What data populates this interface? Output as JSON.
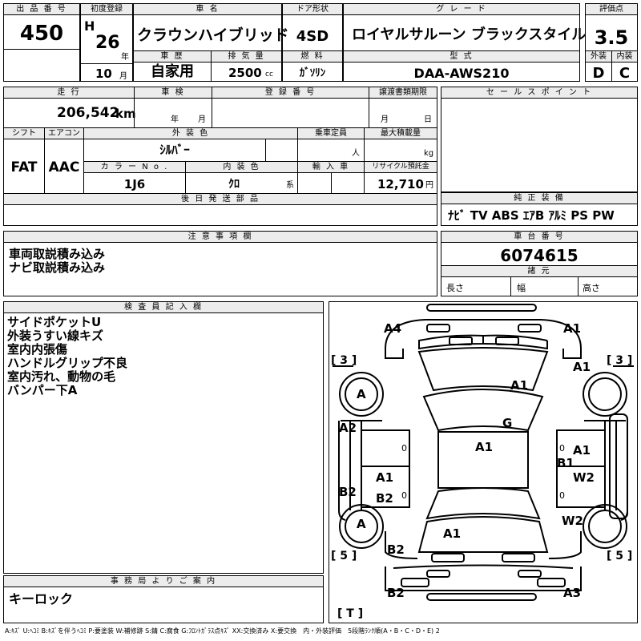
{
  "header": {
    "lot_label": "出 品 番 号",
    "lot_value": "450",
    "reg_label": "初度登録",
    "era": "H",
    "year": "26",
    "year_unit": "年",
    "month": "10",
    "month_unit": "月",
    "history_label": "車 歴",
    "history_value": "自家用",
    "name_label": "車 名",
    "name_value": "クラウンハイブリッド",
    "displacement_label": "排 気 量",
    "displacement_value": "2500",
    "displacement_unit": "cc",
    "door_label": "ドア形状",
    "door_value": "4SD",
    "fuel_label": "燃 料",
    "fuel_value": "ｶﾞｿﾘﾝ",
    "grade_label": "グ レ ー ド",
    "grade_value": "ロイヤルサルーン ブラックスタイル",
    "model_label": "型 式",
    "model_value": "DAA-AWS210",
    "score_label": "評価点",
    "score_value": "3.5",
    "exterior_label": "外装",
    "exterior_value": "D",
    "interior_label": "内装",
    "interior_value": "C"
  },
  "specs": {
    "mileage_label": "走 行",
    "mileage_value": "206,542",
    "mileage_unit": "km",
    "inspection_label": "車 検",
    "inspection_year": "年",
    "inspection_month": "月",
    "regno_label": "登 録 番 号",
    "transfer_label": "譲渡書類期限",
    "transfer_month": "月",
    "transfer_day": "日",
    "shift_label": "シフト",
    "shift_value": "FAT",
    "ac_label": "エアコン",
    "ac_value": "AAC",
    "color_label": "外 装 色",
    "color_value": "ｼﾙﾊﾞｰ",
    "capacity_label": "乗車定員",
    "capacity_unit": "人",
    "load_label": "最大積載量",
    "load_unit": "kg",
    "colorno_label": "カ ラ ー N o .",
    "colorno_value": "1J6",
    "interior_color_label": "内 装 色",
    "interior_color_value": "ｸﾛ",
    "interior_color_unit": "系",
    "import_label": "輸 入 車",
    "recycle_label": "リサイクル預託金",
    "recycle_value": "12,710",
    "recycle_unit": "円",
    "parts_label": "後 日 発 送 部 品"
  },
  "sales": {
    "label": "セ ー ル ス ポ イ ン ト"
  },
  "equipment": {
    "label": "純 正 装 備",
    "value": "ﾅﾋﾞ TV ABS ｴｱB ｱﾙﾐ PS PW"
  },
  "notes": {
    "label": "注 意 事 項 欄",
    "lines": [
      "車両取説積み込み",
      "ナビ取説積み込み"
    ]
  },
  "chassis": {
    "label": "車 台 番 号",
    "value": "6074615",
    "dims_label": "諸 元",
    "length_label": "長さ",
    "width_label": "幅",
    "height_label": "高さ"
  },
  "inspector": {
    "label": "検 査 員 記 入 欄",
    "lines": [
      "サイドポケットU",
      "外装うすい線キズ",
      "室内内張傷",
      "ハンドルグリップ不良",
      "室内汚れ、動物の毛",
      "バンパー下A"
    ]
  },
  "office": {
    "label": "事 務 局 よ り ご 案 内",
    "value": "キーロック"
  },
  "diagram": {
    "marks": {
      "a4_fl": "A4",
      "a1_fr": "A1",
      "a1_rf": "A1",
      "a1_hood": "A1",
      "g_glass": "G",
      "a2_left": "A2",
      "a1_roof": "A1",
      "a1_rdoor": "A1",
      "b1_rdoor": "B1",
      "w2_rdoor": "W2",
      "a1_ldoor": "A1",
      "b2_ldoor": "B2",
      "b2_lside": "B2",
      "w2_rrear": "W2",
      "a1_trunk": "A1",
      "b2_lrear": "B2",
      "b2_rear": "B2",
      "a3_rear": "A3",
      "a_wheel_fl": "A",
      "a_wheel_rl": "A"
    },
    "brackets": {
      "fl": "[ 3 ]",
      "fr": "[ 3 ]",
      "rl": "[ 5 ]",
      "rr": "[ 5 ]",
      "t": "[ T ]"
    },
    "zeros": [
      "0",
      "0",
      "0",
      "0"
    ]
  },
  "legend": "A:ｷｽﾞ U:ﾍｺﾐ B:ｷｽﾞを伴うﾍｺﾐ P:要塗装 W:補修跡 S:錆 C:腐食 G:ﾌﾛﾝﾄｶﾞﾗｽ点ｷｽﾞ XX:交換済み X:要交換　内・外装評価　5段階ﾗﾝｸ順(A・B・C・D・E) 2"
}
